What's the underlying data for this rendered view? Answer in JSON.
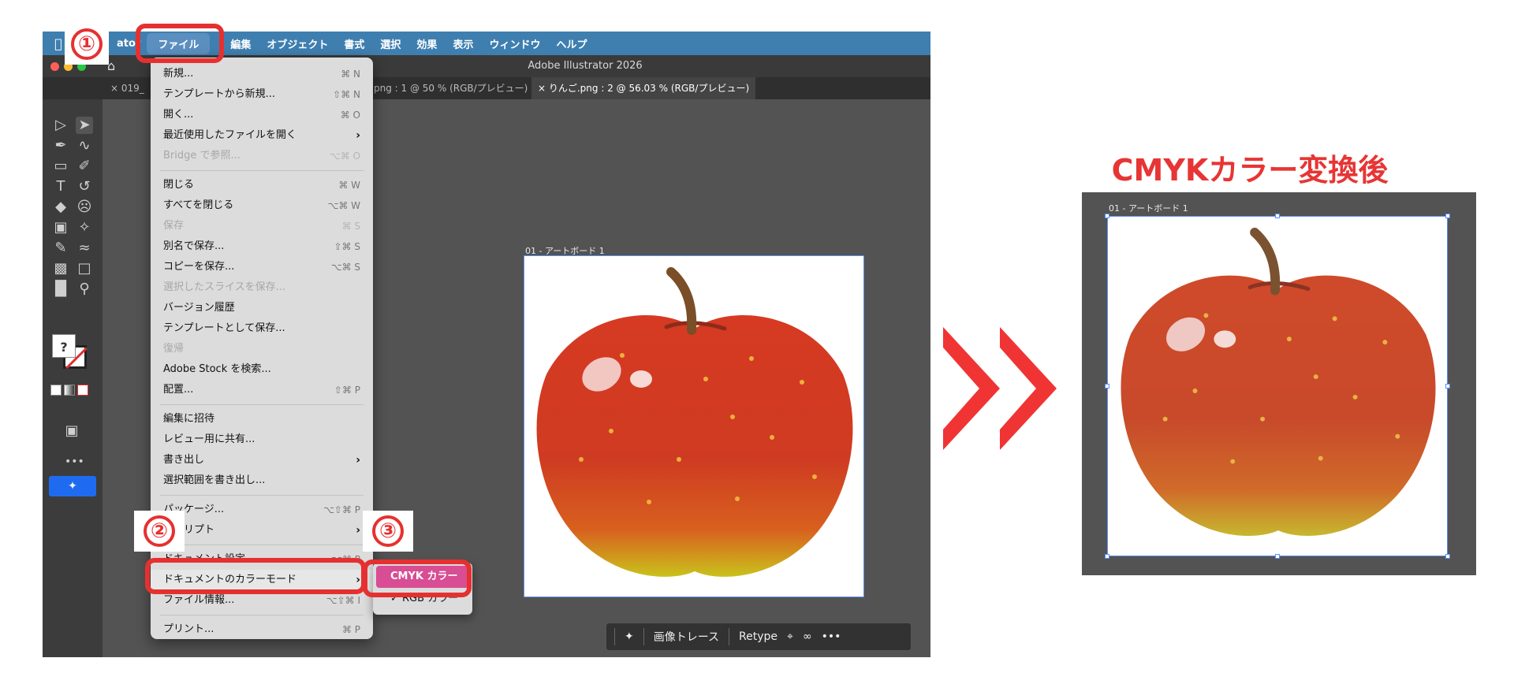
{
  "menubar": {
    "app_name": "ator",
    "items": [
      "ファイル",
      "編集",
      "オブジェクト",
      "書式",
      "選択",
      "効果",
      "表示",
      "ウィンドウ",
      "ヘルプ"
    ]
  },
  "window": {
    "title": "Adobe Illustrator 2026"
  },
  "tabs": [
    {
      "label": "× 019_",
      "active": false
    },
    {
      "label": "png : 1 @ 50 % (RGB/プレビュー)",
      "active": false
    },
    {
      "label": "× りんご.png : 2 @ 56.03 % (RGB/プレビュー)",
      "active": true
    }
  ],
  "artboard_label": "01 - アートボード 1",
  "file_menu": {
    "items": [
      {
        "label": "新規...",
        "shortcut": "⌘ N",
        "disabled": false
      },
      {
        "label": "テンプレートから新規...",
        "shortcut": "⇧⌘ N",
        "disabled": false
      },
      {
        "label": "開く...",
        "shortcut": "⌘ O",
        "disabled": false
      },
      {
        "label": "最近使用したファイルを開く",
        "shortcut": "›",
        "disabled": false
      },
      {
        "label": "Bridge で参照...",
        "shortcut": "⌥⌘ O",
        "disabled": true
      },
      {
        "label": "閉じる",
        "shortcut": "⌘ W",
        "disabled": false
      },
      {
        "label": "すべてを閉じる",
        "shortcut": "⌥⌘ W",
        "disabled": false
      },
      {
        "label": "保存",
        "shortcut": "⌘ S",
        "disabled": true
      },
      {
        "label": "別名で保存...",
        "shortcut": "⇧⌘ S",
        "disabled": false
      },
      {
        "label": "コピーを保存...",
        "shortcut": "⌥⌘ S",
        "disabled": false
      },
      {
        "label": "選択したスライスを保存...",
        "shortcut": "",
        "disabled": true
      },
      {
        "label": "バージョン履歴",
        "shortcut": "",
        "disabled": false
      },
      {
        "label": "テンプレートとして保存...",
        "shortcut": "",
        "disabled": false
      },
      {
        "label": "復帰",
        "shortcut": "",
        "disabled": true
      },
      {
        "label": "Adobe Stock を検索...",
        "shortcut": "",
        "disabled": false
      },
      {
        "label": "配置...",
        "shortcut": "⇧⌘ P",
        "disabled": false
      },
      {
        "label": "編集に招待",
        "shortcut": "",
        "disabled": false
      },
      {
        "label": "レビュー用に共有...",
        "shortcut": "",
        "disabled": false
      },
      {
        "label": "書き出し",
        "shortcut": "›",
        "disabled": false
      },
      {
        "label": "選択範囲を書き出し...",
        "shortcut": "",
        "disabled": false
      },
      {
        "label": "パッケージ...",
        "shortcut": "⌥⇧⌘ P",
        "disabled": false
      },
      {
        "label": "スクリプト",
        "shortcut": "›",
        "disabled": false
      },
      {
        "label": "ドキュメント設定...",
        "shortcut": "⌥⌘ P",
        "disabled": false
      },
      {
        "label": "ドキュメントのカラーモード",
        "shortcut": "›",
        "disabled": false
      },
      {
        "label": "ファイル情報...",
        "shortcut": "⌥⇧⌘ I",
        "disabled": false
      },
      {
        "label": "プリント...",
        "shortcut": "⌘ P",
        "disabled": false
      }
    ]
  },
  "color_mode_submenu": {
    "items": [
      {
        "label": "CMYK カラー",
        "selected": true
      },
      {
        "label": "✓ RGB カラー",
        "selected": false
      }
    ]
  },
  "context_bar": {
    "image_trace": "画像トレース",
    "retype": "Retype",
    "more": "•••"
  },
  "annotations": {
    "step1": "①",
    "step2": "②",
    "step3": "③"
  },
  "after": {
    "title": "CMYKカラー変換後",
    "artboard_label": "01 - アートボード 1"
  },
  "colors": {
    "annotation_red": "#e63030",
    "menubar_blue": "#3f7fb0",
    "submenu_highlight": "#d84d93",
    "arrow_red": "#f03434"
  }
}
